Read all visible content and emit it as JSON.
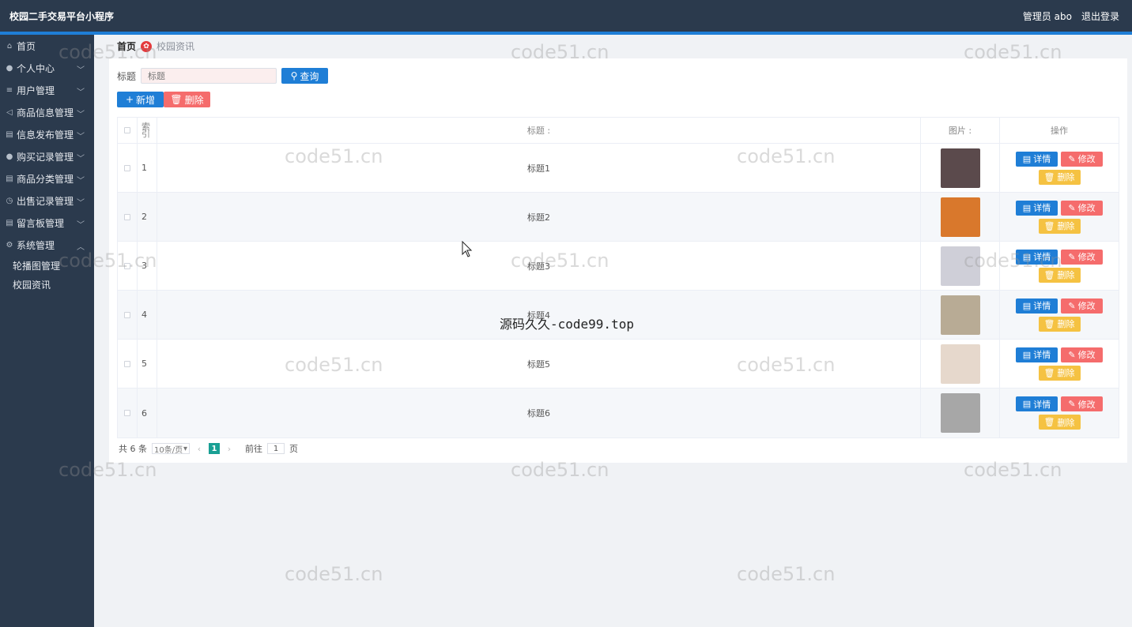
{
  "app": {
    "title": "校园二手交易平台小程序",
    "user_label": "管理员 abo",
    "logout": "退出登录",
    "accent": "#1f7ed6"
  },
  "sidebar": {
    "items": [
      {
        "icon": "home-icon",
        "glyph": "⌂",
        "label": "首页",
        "has_chevron": false
      },
      {
        "icon": "user-icon",
        "glyph": "●",
        "label": "个人中心",
        "has_chevron": true
      },
      {
        "icon": "list-icon",
        "glyph": "≡",
        "label": "用户管理",
        "has_chevron": true
      },
      {
        "icon": "send-icon",
        "glyph": "◁",
        "label": "商品信息管理",
        "has_chevron": true
      },
      {
        "icon": "doc-icon",
        "glyph": "▤",
        "label": "信息发布管理",
        "has_chevron": true
      },
      {
        "icon": "user-icon",
        "glyph": "●",
        "label": "购买记录管理",
        "has_chevron": true
      },
      {
        "icon": "doc-icon",
        "glyph": "▤",
        "label": "商品分类管理",
        "has_chevron": true
      },
      {
        "icon": "clock-icon",
        "glyph": "◷",
        "label": "出售记录管理",
        "has_chevron": true
      },
      {
        "icon": "doc-icon",
        "glyph": "▤",
        "label": "留言板管理",
        "has_chevron": true
      },
      {
        "icon": "setting-icon",
        "glyph": "⚙",
        "label": "系统管理",
        "has_chevron": true,
        "expanded": true
      }
    ],
    "subitems": [
      "轮播图管理",
      "校园资讯"
    ]
  },
  "breadcrumb": {
    "home": "首页",
    "current": "校园资讯"
  },
  "search": {
    "label": "标题",
    "placeholder": "标题",
    "button": "查询"
  },
  "actions": {
    "add": "新增",
    "delete": "删除"
  },
  "table": {
    "headers": {
      "index": "索引",
      "title": "标题 :",
      "picture": "图片 :",
      "operation": "操作"
    },
    "rows": [
      {
        "index": "1",
        "title": "标题1",
        "thumb_color": "#5b4a4c"
      },
      {
        "index": "2",
        "title": "标题2",
        "thumb_color": "#d9782c"
      },
      {
        "index": "3",
        "title": "标题3",
        "thumb_color": "#cfcfd8"
      },
      {
        "index": "4",
        "title": "标题4",
        "thumb_color": "#b8ab95"
      },
      {
        "index": "5",
        "title": "标题5",
        "thumb_color": "#e6d8cc"
      },
      {
        "index": "6",
        "title": "标题6",
        "thumb_color": "#a7a7a7"
      }
    ],
    "op_labels": {
      "detail": "详情",
      "edit": "修改",
      "delete": "删除"
    }
  },
  "pagination": {
    "total": "共 6 条",
    "page_size": "10条/页",
    "current_page": "1",
    "goto_prefix": "前往",
    "goto_value": "1",
    "goto_suffix": "页"
  },
  "watermarks": {
    "text": "code51.cn",
    "center_text": "源码久久-code99.top"
  }
}
